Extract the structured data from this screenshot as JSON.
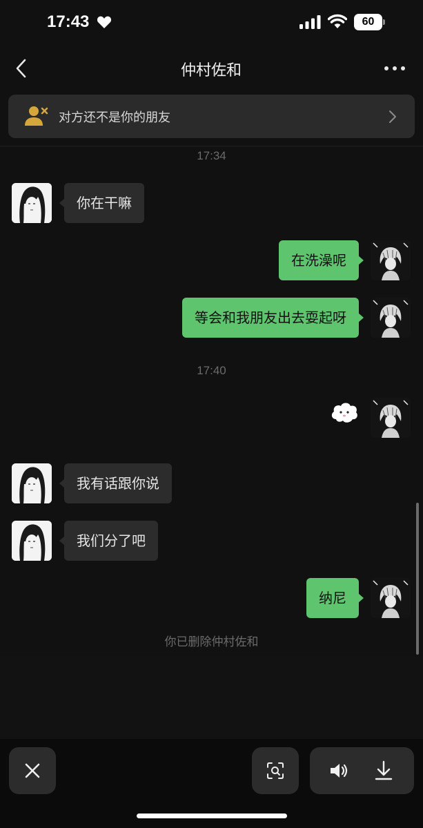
{
  "status_bar": {
    "time": "17:43",
    "battery": "60"
  },
  "header": {
    "title": "仲村佐和",
    "back_icon": "chevron-left-icon",
    "more_icon": "more-dots-icon"
  },
  "banner": {
    "text": "对方还不是你的朋友",
    "icon": "user-blocked-icon"
  },
  "chat": {
    "timestamps": [
      "17:34",
      "17:40"
    ],
    "messages": [
      {
        "side": "incoming",
        "text": "你在干嘛"
      },
      {
        "side": "outgoing",
        "text": "在洗澡呢"
      },
      {
        "side": "outgoing",
        "text": "等会和我朋友出去耍起呀"
      },
      {
        "side": "outgoing",
        "sticker": "cloud-sticker"
      },
      {
        "side": "incoming",
        "text": "我有话跟你说"
      },
      {
        "side": "incoming",
        "text": "我们分了吧"
      },
      {
        "side": "outgoing",
        "text": "纳尼"
      }
    ],
    "system_note": "你已删除仲村佐和"
  },
  "toolbar": {
    "close_icon": "close-icon",
    "scan_icon": "scan-icon",
    "volume_icon": "volume-icon",
    "download_icon": "download-icon"
  },
  "colors": {
    "background": "#111111",
    "incoming_bubble": "#2c2c2c",
    "outgoing_bubble": "#5ec46e",
    "banner_icon": "#d7a63a"
  }
}
